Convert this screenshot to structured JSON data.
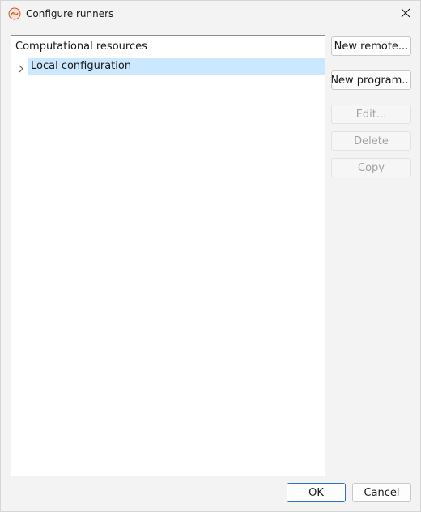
{
  "window": {
    "title": "Configure runners",
    "icon": "app-logo-icon",
    "close_icon": "close-icon"
  },
  "tree": {
    "header": "Computational resources",
    "items": [
      {
        "label": "Local configuration",
        "expanded": false,
        "selected": true
      }
    ]
  },
  "actions": {
    "new_remote": "New remote...",
    "new_program": "New program...",
    "edit": "Edit...",
    "delete": "Delete",
    "copy": "Copy"
  },
  "footer": {
    "ok": "OK",
    "cancel": "Cancel"
  },
  "colors": {
    "selection": "#cce8ff",
    "default_button_border": "#2b72c4",
    "disabled_text": "#a3a3a3"
  }
}
